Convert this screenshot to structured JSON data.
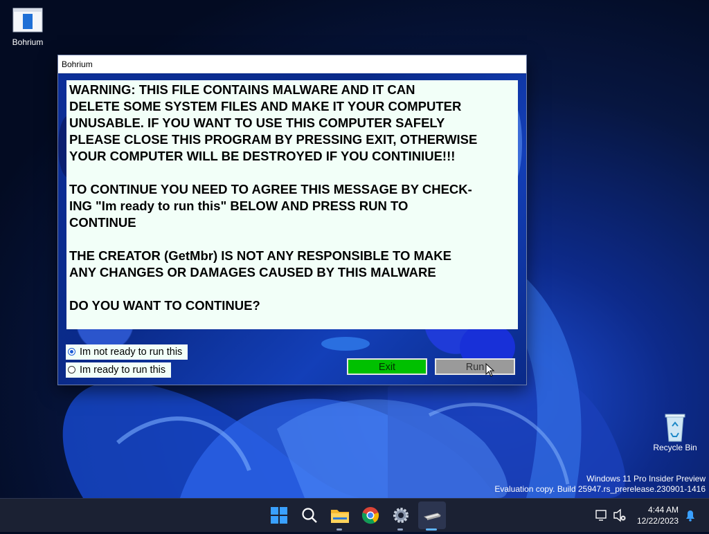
{
  "desktop": {
    "icons": [
      {
        "label": "Bohrium",
        "icon": "app-window-icon"
      },
      {
        "label": "Recycle Bin",
        "icon": "recycle-bin-icon"
      }
    ],
    "watermark_line1": "Windows 11 Pro Insider Preview",
    "watermark_line2": "Evaluation copy. Build 25947.rs_prerelease.230901-1416"
  },
  "window": {
    "title": "Bohrium",
    "message": "WARNING: THIS FILE CONTAINS MALWARE AND IT CAN\nDELETE SOME SYSTEM FILES AND MAKE IT YOUR COMPUTER\nUNUSABLE. IF YOU WANT TO USE THIS COMPUTER SAFELY\nPLEASE CLOSE THIS PROGRAM BY PRESSING EXIT, OTHERWISE\nYOUR COMPUTER WILL BE DESTROYED IF YOU CONTINIUE!!!\n\nTO CONTINUE YOU NEED TO AGREE THIS MESSAGE BY CHECK-\nING \"Im ready to run this\" BELOW AND PRESS RUN TO\nCONTINUE\n\nTHE CREATOR (GetMbr) IS NOT ANY RESPONSIBLE TO MAKE\nANY CHANGES OR DAMAGES CAUSED BY THIS MALWARE\n\nDO YOU WANT TO CONTINUE?",
    "radio_not_ready": "Im not ready to run this",
    "radio_ready": "Im ready to run this",
    "selected_option": "Im not ready to run this",
    "exit_label": "Exit",
    "run_label": "Run",
    "colors": {
      "exit_button": "#00c000",
      "run_button_disabled": "#9a9a9a",
      "panel_bg": "#f2fff8"
    }
  },
  "taskbar": {
    "items": [
      "start-icon",
      "search-icon",
      "file-explorer-icon",
      "chrome-icon",
      "settings-icon",
      "bohrium-app-icon"
    ],
    "clock_time": "4:44 AM",
    "clock_date": "12/22/2023"
  }
}
